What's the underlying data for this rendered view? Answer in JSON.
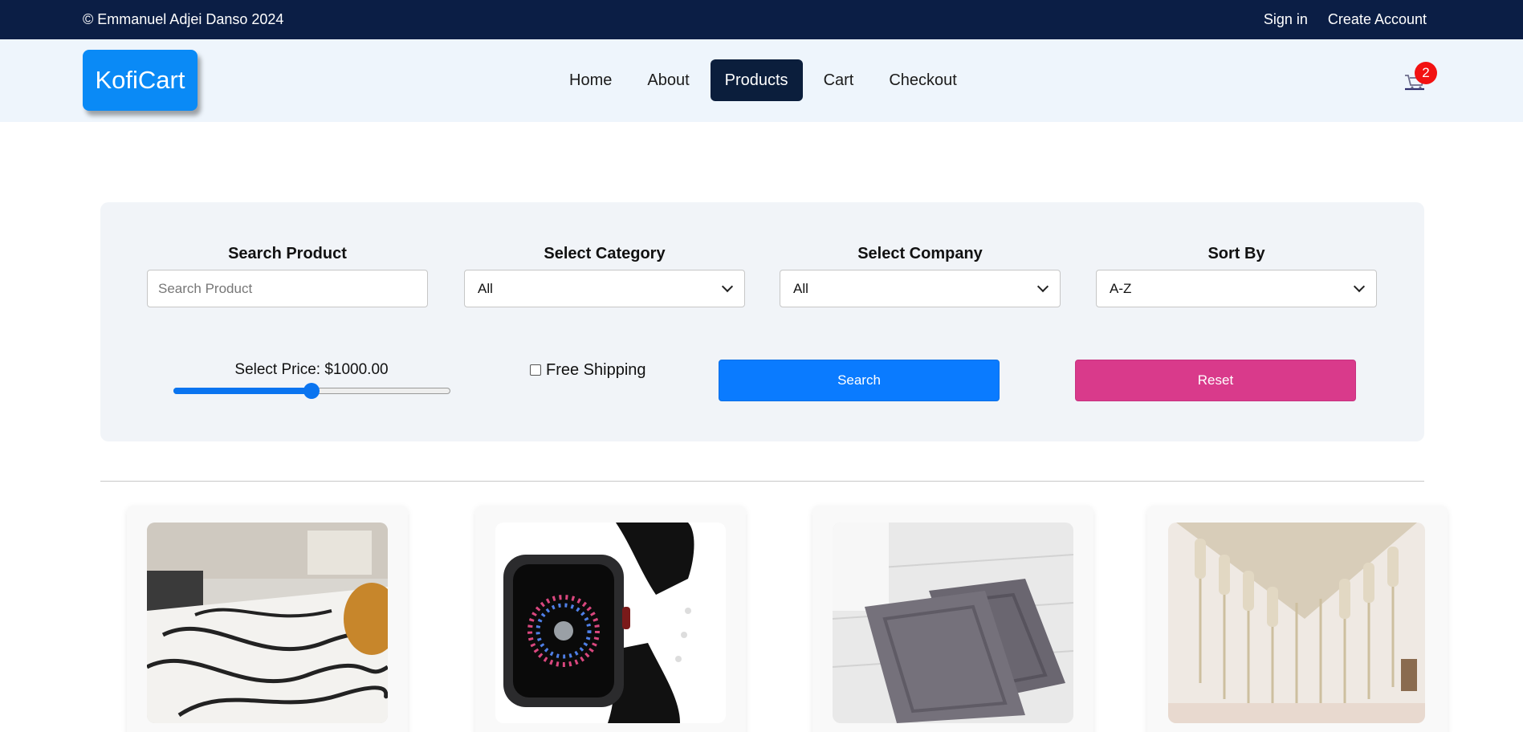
{
  "topbar": {
    "copyright": "© Emmanuel Adjei Danso 2024",
    "sign_in": "Sign in",
    "create_account": "Create Account"
  },
  "nav": {
    "logo": "KofiCart",
    "items": [
      {
        "label": "Home",
        "active": false
      },
      {
        "label": "About",
        "active": false
      },
      {
        "label": "Products",
        "active": true
      },
      {
        "label": "Cart",
        "active": false
      },
      {
        "label": "Checkout",
        "active": false
      }
    ],
    "cart_count": "2",
    "cart_icon": "cart-icon"
  },
  "filters": {
    "search_label": "Search Product",
    "search_placeholder": "Search Product",
    "category_label": "Select Category",
    "category_value": "All",
    "company_label": "Select Company",
    "company_value": "All",
    "sort_label": "Sort By",
    "sort_value": "A-Z",
    "price_label": "Select Price: $1000.00",
    "price_fraction": 0.5,
    "free_shipping_label": "Free Shipping",
    "free_shipping_checked": false,
    "search_button": "Search",
    "reset_button": "Reset"
  },
  "colors": {
    "topbar": "#0b1e45",
    "brand": "#0a8af6",
    "search_button": "#0a7bff",
    "reset_button": "#d93a8b",
    "badge": "#f21212"
  },
  "products": [
    {
      "image": "patterned-rug-image"
    },
    {
      "image": "smartwatch-image"
    },
    {
      "image": "bath-mats-image"
    },
    {
      "image": "macrame-wall-hanging-image"
    }
  ]
}
